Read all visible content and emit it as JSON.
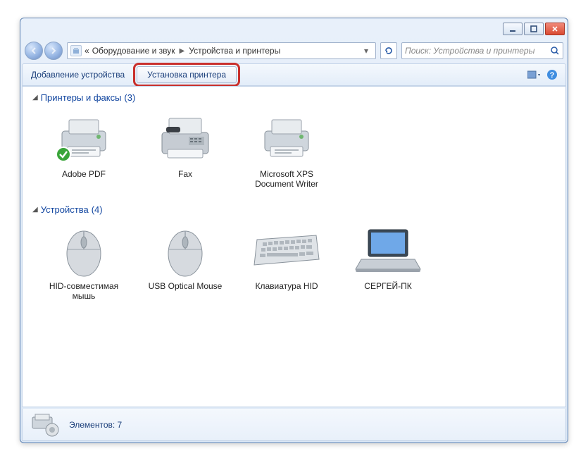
{
  "breadcrumb": {
    "chevrons": "«",
    "path1": "Оборудование и звук",
    "path2": "Устройства и принтеры"
  },
  "search": {
    "placeholder": "Поиск: Устройства и принтеры"
  },
  "toolbar": {
    "add_device": "Добавление устройства",
    "install_printer": "Установка принтера"
  },
  "groups": {
    "printers": {
      "title": "Принтеры и факсы",
      "count": "(3)"
    },
    "devices": {
      "title": "Устройства",
      "count": "(4)"
    }
  },
  "printers": [
    {
      "label": "Adobe PDF"
    },
    {
      "label": "Fax"
    },
    {
      "label": "Microsoft XPS Document Writer"
    }
  ],
  "devices": [
    {
      "label": "HID-совместимая мышь"
    },
    {
      "label": "USB Optical Mouse"
    },
    {
      "label": "Клавиатура HID"
    },
    {
      "label": "СЕРГЕЙ-ПК"
    }
  ],
  "details": {
    "elements_label": "Элементов: 7"
  }
}
